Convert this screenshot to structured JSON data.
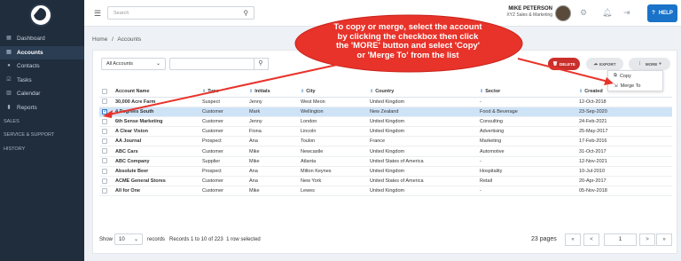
{
  "topbar": {
    "search_placeholder": "Search",
    "user_name": "MIKE PETERSON",
    "user_company": "XYZ Sales & Marketing",
    "help_label": "HELP"
  },
  "sidebar": {
    "items": [
      {
        "label": "Dashboard",
        "icon": "dashboard-icon"
      },
      {
        "label": "Accounts",
        "icon": "building-icon",
        "active": true
      },
      {
        "label": "Contacts",
        "icon": "people-icon"
      },
      {
        "label": "Tasks",
        "icon": "checklist-icon"
      },
      {
        "label": "Calendar",
        "icon": "calendar-icon"
      },
      {
        "label": "Reports",
        "icon": "reports-icon"
      }
    ],
    "sections": [
      "SALES",
      "SERVICE & SUPPORT",
      "HISTORY"
    ]
  },
  "breadcrumb": {
    "home": "Home",
    "sep": "/",
    "current": "Accounts"
  },
  "toolbar": {
    "filter_value": "All Accounts",
    "delete_label": "DELETE",
    "export_label": "EXPORT",
    "more_label": "MORE"
  },
  "dropdown": {
    "items": [
      "Copy",
      "Merge To"
    ]
  },
  "callout": {
    "lines": [
      "To copy or merge, select the account",
      "by clicking the checkbox then click",
      "the 'MORE' button and select 'Copy'",
      "or 'Merge To' from the list"
    ],
    "color": "#e8332a"
  },
  "table": {
    "columns": [
      "Account Name",
      "Type",
      "Initials",
      "City",
      "Country",
      "Sector",
      "Created"
    ],
    "rows": [
      [
        "30,000 Acre Farm",
        "Suspect",
        "Jenny",
        "West Meon",
        "United Kingdom",
        "-",
        "12-Oct-2018"
      ],
      [
        "4 Degrees South",
        "Customer",
        "Mark",
        "Wellington",
        "New Zealand",
        "Food & Beverage",
        "23-Sep-2020"
      ],
      [
        "6th Sense Marketing",
        "Customer",
        "Jenny",
        "London",
        "United Kingdom",
        "Consulting",
        "24-Feb-2021"
      ],
      [
        "A Clear Vision",
        "Customer",
        "Fiona",
        "Lincoln",
        "United Kingdom",
        "Advertising",
        "25-May-2017"
      ],
      [
        "AA Journal",
        "Prospect",
        "Ana",
        "Toulon",
        "France",
        "Marketing",
        "17-Feb-2016"
      ],
      [
        "ABC Cars",
        "Customer",
        "Mike",
        "Newcastle",
        "United Kingdom",
        "Automotive",
        "31-Oct-2017"
      ],
      [
        "ABC Company",
        "Supplier",
        "Mike",
        "Atlanta",
        "United States of America",
        "-",
        "12-Nov-2021"
      ],
      [
        "Absolute Beer",
        "Prospect",
        "Ana",
        "Milton Keynes",
        "United Kingdom",
        "Hospitality",
        "10-Jul-2010"
      ],
      [
        "ACME General Stores",
        "Customer",
        "Ana",
        "New York",
        "United States of America",
        "Retail",
        "20-Apr-2017"
      ],
      [
        "All for One",
        "Customer",
        "Mike",
        "Lewes",
        "United Kingdom",
        "-",
        "05-Nov-2018"
      ]
    ],
    "selected_row": 1
  },
  "footer": {
    "show_label": "Show",
    "page_size": "10",
    "records_label": "records",
    "records_info": "Records 1 to 10 of 223",
    "selection_info": "1 row selected",
    "pages_label": "23 pages",
    "current_page": "1",
    "first": "«",
    "prev": "<",
    "next": ">",
    "last": "»"
  }
}
